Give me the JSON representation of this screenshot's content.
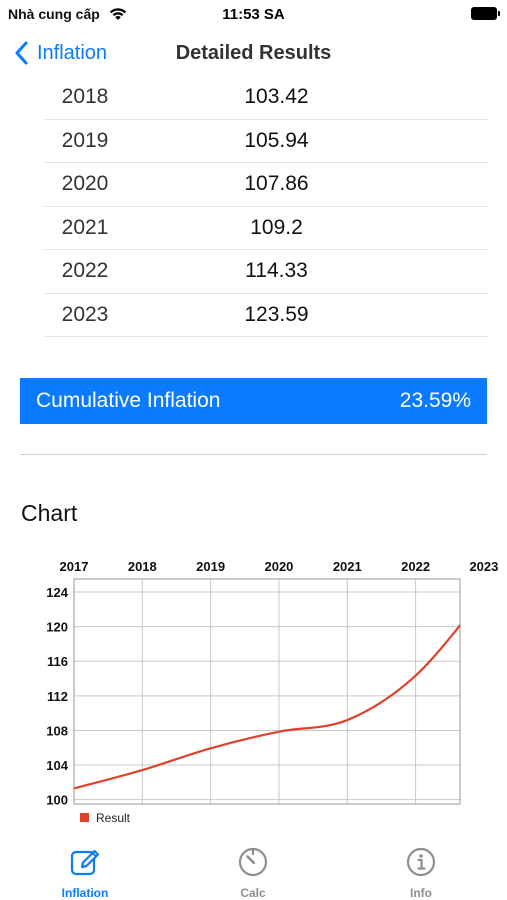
{
  "status_bar": {
    "carrier": "Nhà cung cấp",
    "time": "11:53 SA"
  },
  "nav": {
    "back_label": "Inflation",
    "title": "Detailed Results"
  },
  "results": [
    {
      "year": "2018",
      "value": "103.42"
    },
    {
      "year": "2019",
      "value": "105.94"
    },
    {
      "year": "2020",
      "value": "107.86"
    },
    {
      "year": "2021",
      "value": "109.2"
    },
    {
      "year": "2022",
      "value": "114.33"
    },
    {
      "year": "2023",
      "value": "123.59"
    }
  ],
  "cumulative": {
    "label": "Cumulative Inflation",
    "value": "23.59%"
  },
  "chart_section": {
    "title": "Chart"
  },
  "chart_data": {
    "type": "line",
    "x": [
      2017,
      2018,
      2019,
      2020,
      2021,
      2022,
      2023
    ],
    "x_tick_labels": [
      "2017",
      "2018",
      "2019",
      "2020",
      "2021",
      "2022",
      "2023"
    ],
    "series": [
      {
        "name": "Result",
        "color": "#e0412a",
        "values": [
          101.3,
          103.42,
          105.94,
          107.86,
          109.2,
          114.33,
          123.59
        ]
      }
    ],
    "y_ticks": [
      100,
      104,
      108,
      112,
      116,
      120,
      124
    ],
    "ylim": [
      99.5,
      125.5
    ],
    "xlabel": "",
    "ylabel": "",
    "grid": true,
    "legend_position": "bottom-left",
    "x_axis_position": "top"
  },
  "tabs": [
    {
      "label": "Inflation",
      "icon": "edit-icon",
      "active": true
    },
    {
      "label": "Calc",
      "icon": "timer-icon",
      "active": false
    },
    {
      "label": "Info",
      "icon": "info-icon",
      "active": false
    }
  ],
  "colors": {
    "accent": "#0a7aff",
    "series": "#e0412a",
    "inactive": "#8e8e93"
  }
}
